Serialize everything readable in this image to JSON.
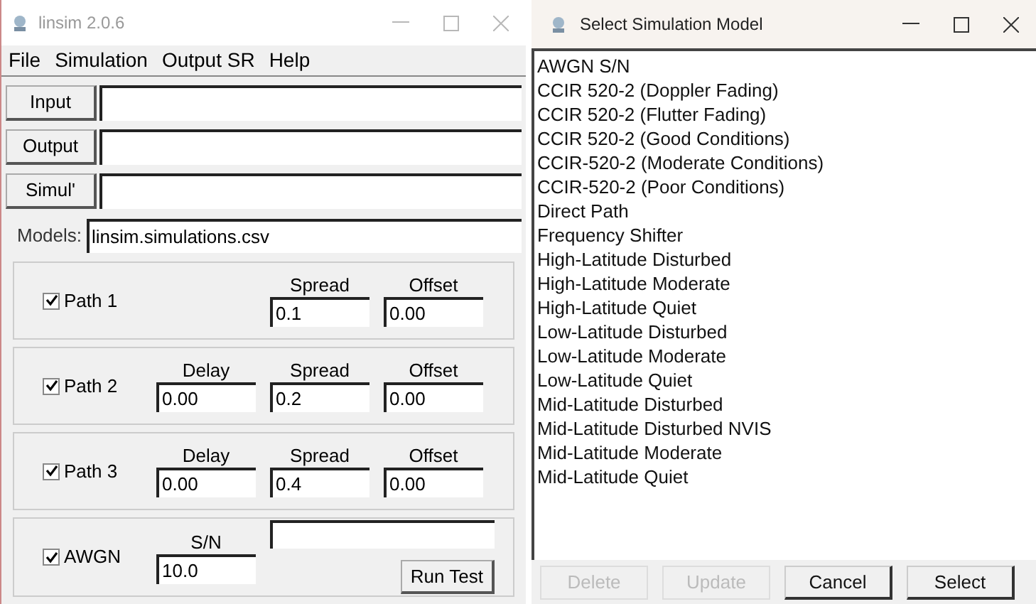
{
  "main_window": {
    "title": "linsim 2.0.6",
    "menu": [
      "File",
      "Simulation",
      "Output SR",
      "Help"
    ],
    "file_rows": [
      {
        "button": "Input",
        "value": ""
      },
      {
        "button": "Output",
        "value": ""
      },
      {
        "button": "Simul'",
        "value": ""
      }
    ],
    "models": {
      "label": "Models:",
      "value": "linsim.simulations.csv"
    },
    "paths": [
      {
        "label": "Path 1",
        "checked": true,
        "fields": [
          {
            "kind": "blank"
          },
          {
            "kind": "field",
            "label": "Spread",
            "value": "0.1"
          },
          {
            "kind": "field",
            "label": "Offset",
            "value": "0.00"
          }
        ]
      },
      {
        "label": "Path 2",
        "checked": true,
        "fields": [
          {
            "kind": "field",
            "label": "Delay",
            "value": "0.00"
          },
          {
            "kind": "field",
            "label": "Spread",
            "value": "0.2"
          },
          {
            "kind": "field",
            "label": "Offset",
            "value": "0.00"
          }
        ]
      },
      {
        "label": "Path 3",
        "checked": true,
        "fields": [
          {
            "kind": "field",
            "label": "Delay",
            "value": "0.00"
          },
          {
            "kind": "field",
            "label": "Spread",
            "value": "0.4"
          },
          {
            "kind": "field",
            "label": "Offset",
            "value": "0.00"
          }
        ]
      }
    ],
    "awgn": {
      "label": "AWGN",
      "checked": true,
      "sn_label": "S/N",
      "sn_value": "10.0"
    },
    "run_button": "Run Test"
  },
  "dialog": {
    "title": "Select Simulation Model",
    "models": [
      "AWGN S/N",
      "CCIR 520-2 (Doppler Fading)",
      "CCIR 520-2 (Flutter Fading)",
      "CCIR 520-2 (Good Conditions)",
      "CCIR-520-2 (Moderate Conditions)",
      "CCIR-520-2 (Poor Conditions)",
      "Direct Path",
      "Frequency Shifter",
      "High-Latitude Disturbed",
      "High-Latitude Moderate",
      "High-Latitude Quiet",
      "Low-Latitude Disturbed",
      "Low-Latitude Moderate",
      "Low-Latitude Quiet",
      "Mid-Latitude Disturbed",
      "Mid-Latitude Disturbed NVIS",
      "Mid-Latitude Moderate",
      "Mid-Latitude Quiet"
    ],
    "buttons": [
      {
        "label": "Delete",
        "disabled": true
      },
      {
        "label": "Update",
        "disabled": true
      },
      {
        "label": "Cancel",
        "disabled": false
      },
      {
        "label": "Select",
        "disabled": false
      }
    ]
  }
}
